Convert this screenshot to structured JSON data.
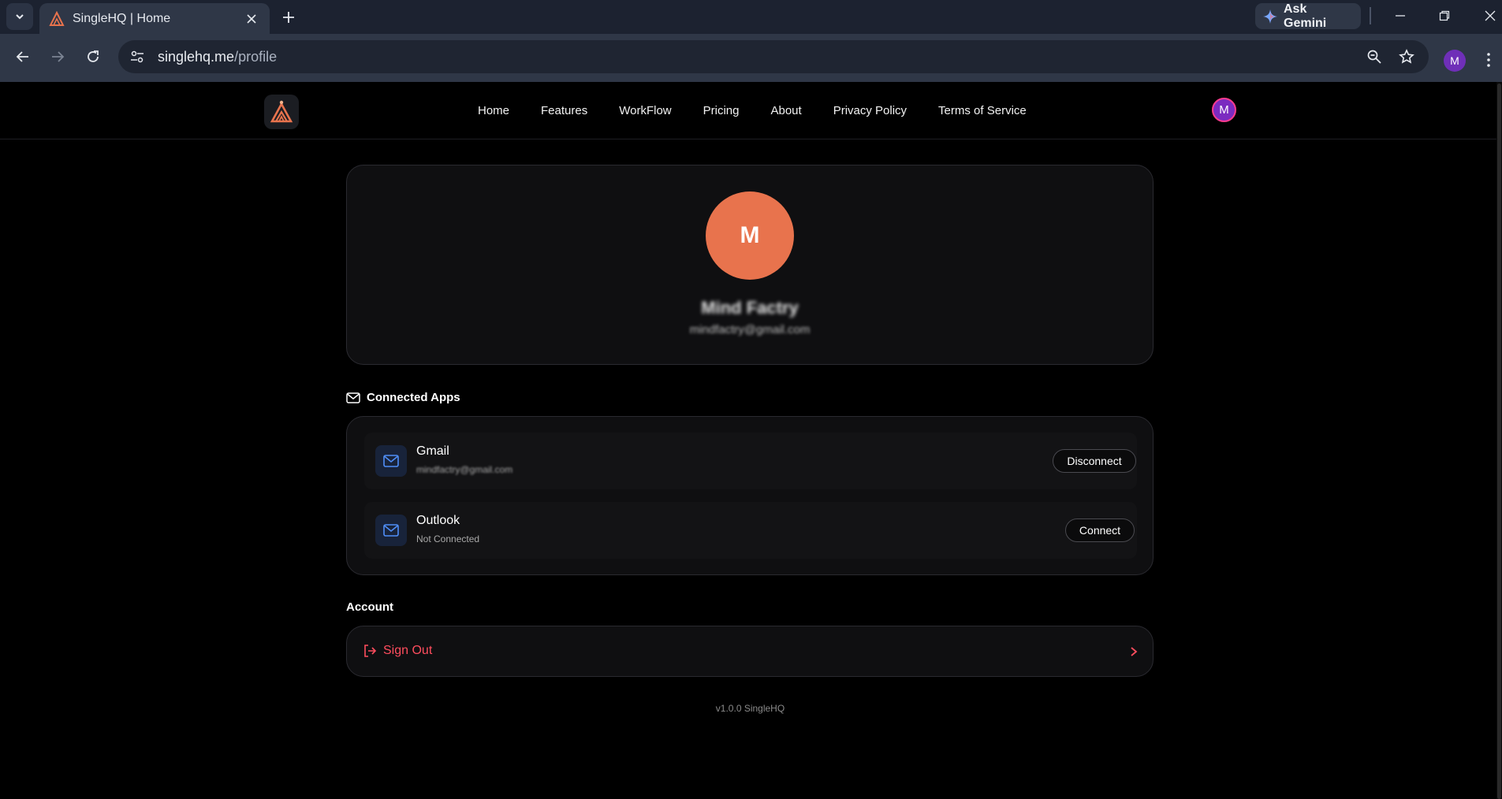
{
  "browser": {
    "tab_title": "SingleHQ | Home",
    "gemini_label": "Ask Gemini",
    "url_host": "singlehq.me",
    "url_path": "/profile",
    "profile_initial": "M"
  },
  "site": {
    "nav": [
      "Home",
      "Features",
      "WorkFlow",
      "Pricing",
      "About",
      "Privacy Policy",
      "Terms of Service"
    ],
    "avatar_initial": "M"
  },
  "profile": {
    "initial": "M",
    "name": "Mind Factry",
    "email": "mindfactry@gmail.com"
  },
  "connected_apps": {
    "title": "Connected Apps",
    "apps": [
      {
        "name": "Gmail",
        "status": "mindfactry@gmail.com",
        "action": "Disconnect"
      },
      {
        "name": "Outlook",
        "status": "Not Connected",
        "action": "Connect"
      }
    ]
  },
  "account": {
    "title": "Account",
    "sign_out": "Sign Out"
  },
  "footer": {
    "version": "v1.0.0 SingleHQ"
  },
  "colors": {
    "accent_orange": "#e8734d",
    "danger": "#ff4d5e",
    "mail_blue": "#4f8ef7",
    "avatar_purple": "#7b2bc0"
  },
  "icons": [
    "tab-search-icon",
    "favicon-icon",
    "close-icon",
    "plus-icon",
    "gemini-icon",
    "minimize-icon",
    "restore-icon",
    "back-icon",
    "forward-icon",
    "reload-icon",
    "tune-icon",
    "zoom-icon",
    "star-icon",
    "kebab-icon",
    "mail-icon",
    "sign-out-icon",
    "chevron-right-icon"
  ]
}
